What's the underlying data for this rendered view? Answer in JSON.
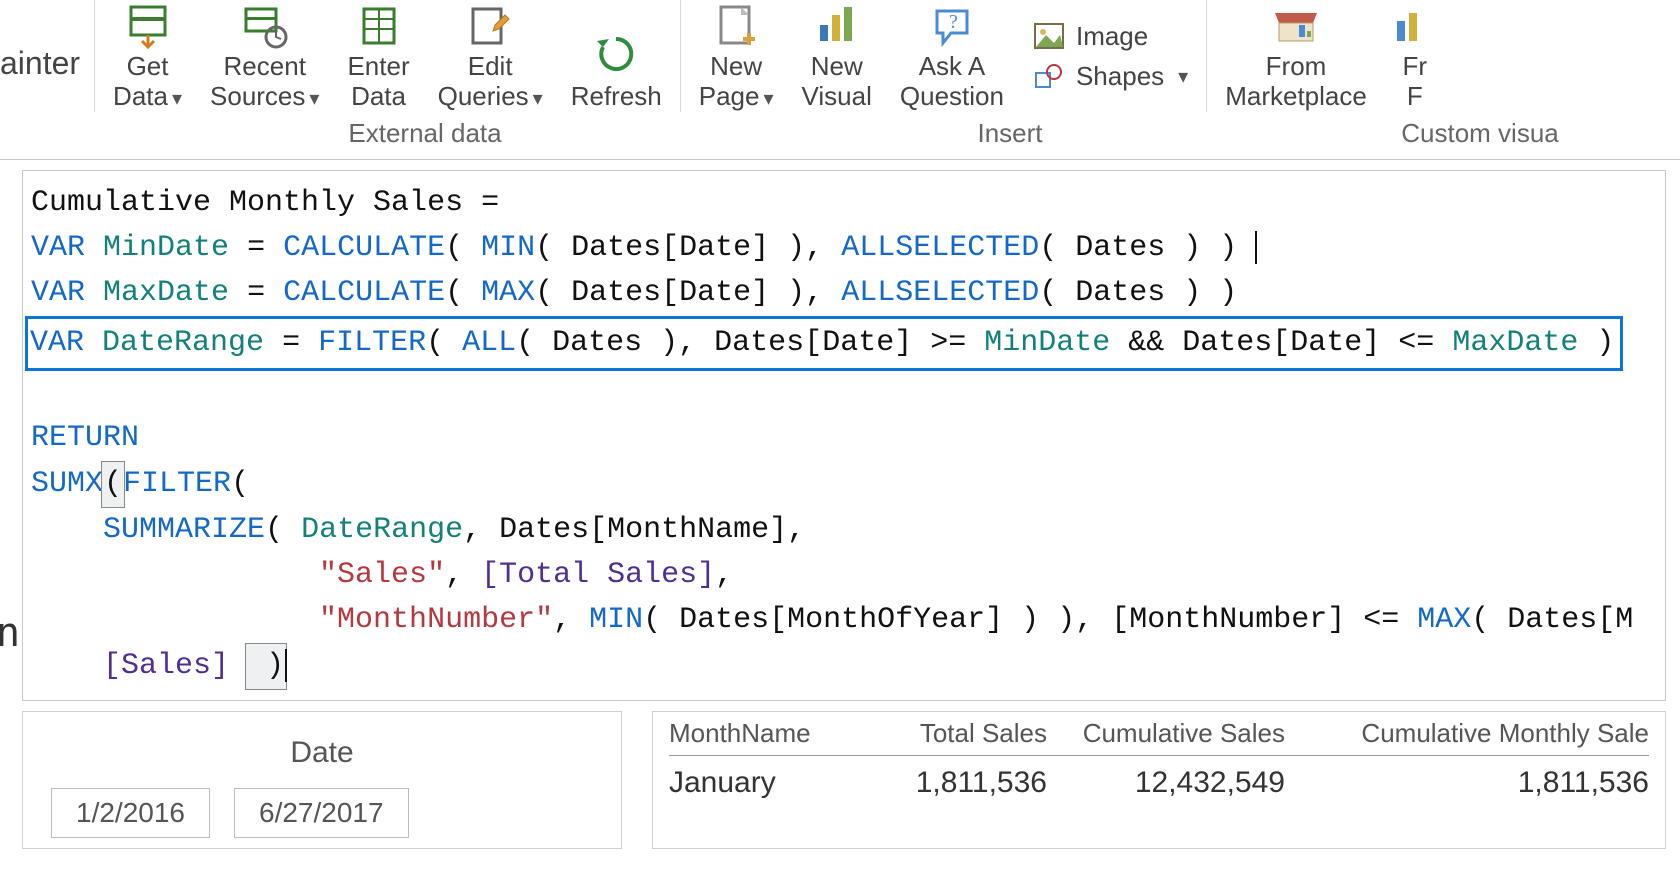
{
  "ribbon": {
    "painter_fragment": "ainter",
    "get_data": "Get\nData",
    "recent_sources": "Recent\nSources",
    "enter_data": "Enter\nData",
    "edit_queries": "Edit\nQueries",
    "refresh": "Refresh",
    "new_page": "New\nPage",
    "new_visual": "New\nVisual",
    "ask_a_question": "Ask A\nQuestion",
    "image": "Image",
    "shapes": "Shapes",
    "from_marketplace": "From\nMarketplace",
    "from_right_fragment": "Fr\nF",
    "group_external": "External data",
    "group_insert": "Insert",
    "group_custom": "Custom visua"
  },
  "code": {
    "l1": "Cumulative Monthly Sales =",
    "l2_var": "VAR",
    "l2_id": "MinDate",
    "l2_eq": " = ",
    "l2_fn1": "CALCULATE",
    "l2_p1": "( ",
    "l2_fn2": "MIN",
    "l2_p2": "( Dates[Date] ), ",
    "l2_fn3": "ALLSELECTED",
    "l2_p3": "( Dates ) ) ",
    "l3_var": "VAR",
    "l3_id": "MaxDate",
    "l3_fn1": "CALCULATE",
    "l3_fn2": "MAX",
    "l3_mid": "( Dates[Date] ), ",
    "l3_fn3": "ALLSELECTED",
    "l3_tail": "( Dates ) )",
    "l4_var": "VAR",
    "l4_id": "DateRange",
    "l4_fn1": "FILTER",
    "l4_fn2": "ALL",
    "l4_mid": "( Dates ), Dates[Date] >= ",
    "l4_v1": "MinDate",
    "l4_amp": " && Dates[Date] <= ",
    "l4_v2": "MaxDate",
    "l4_tail": " )",
    "ret": "RETURN",
    "s1a": "SUMX",
    "s1b": "(",
    "s1c": "FILTER",
    "s1d": "(",
    "s2_fn": "SUMMARIZE",
    "s2_p": "( ",
    "s2_id": "DateRange",
    "s2_tail": ", Dates[MonthName],",
    "s3_str": "\"Sales\"",
    "s3_mid": ", ",
    "s3_col": "[Total Sales]",
    "s3_tail": ",",
    "s4_str": "\"MonthNumber\"",
    "s4_mid": ", ",
    "s4_fn": "MIN",
    "s4_p": "( Dates[MonthOfYear] ) ), [MonthNumber] <= ",
    "s4_fn2": "MAX",
    "s4_tail": "( Dates[M",
    "s5_col": "[Sales]",
    "s5_tail": " )"
  },
  "date_card": {
    "title": "Date",
    "from": "1/2/2016",
    "to": "6/27/2017"
  },
  "table": {
    "h1": "MonthName",
    "h2": "Total Sales",
    "h3": "Cumulative Sales",
    "h4": "Cumulative Monthly Sale",
    "r1_mn": "January",
    "r1_ts": "1,811,536",
    "r1_cs": "12,432,549",
    "r1_cms": "1,811,536"
  }
}
